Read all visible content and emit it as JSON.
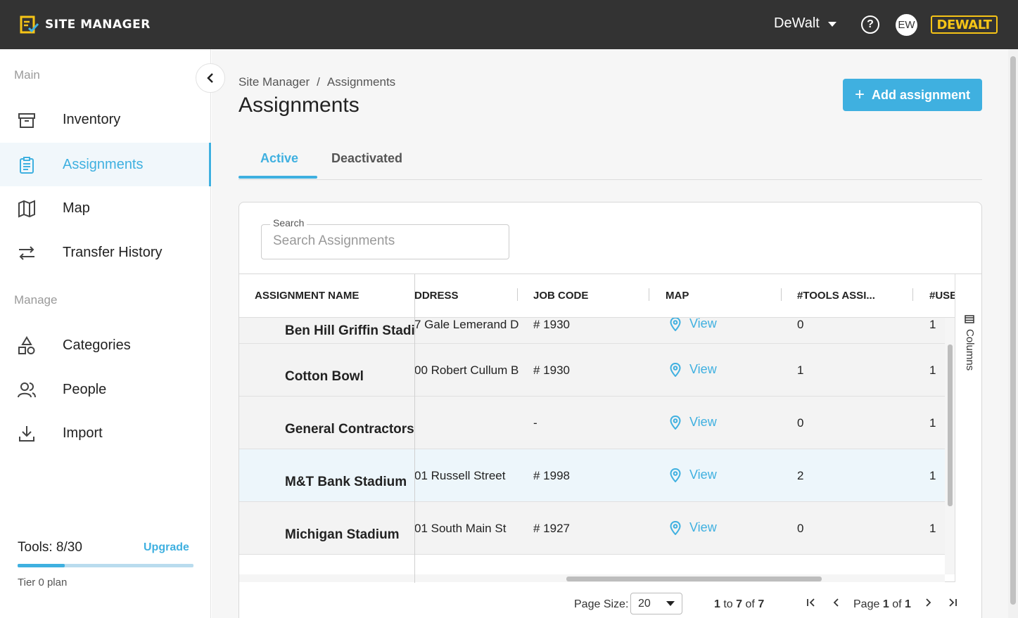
{
  "app": {
    "name": "SITE MANAGER",
    "org": "DeWalt",
    "avatar_initials": "EW",
    "brand": "DEWALT"
  },
  "sidebar": {
    "section_main": "Main",
    "section_manage": "Manage",
    "items": [
      {
        "label": "Inventory",
        "icon": "archive-box-icon"
      },
      {
        "label": "Assignments",
        "icon": "clipboard-icon",
        "active": true
      },
      {
        "label": "Map",
        "icon": "map-icon"
      },
      {
        "label": "Transfer History",
        "icon": "transfer-arrows-icon"
      },
      {
        "label": "Categories",
        "icon": "shapes-icon"
      },
      {
        "label": "People",
        "icon": "people-icon"
      },
      {
        "label": "Import",
        "icon": "download-icon"
      }
    ],
    "tools_label": "Tools: 8/30",
    "tools_used_fraction": 0.267,
    "upgrade": "Upgrade",
    "tier": "Tier 0 plan"
  },
  "main": {
    "breadcrumb": {
      "root": "Site Manager",
      "sep": "/",
      "current": "Assignments"
    },
    "title": "Assignments",
    "add_button": "Add assignment",
    "tabs": [
      {
        "label": "Active",
        "active": true
      },
      {
        "label": "Deactivated"
      }
    ],
    "search": {
      "legend": "Search",
      "placeholder": "Search Assignments"
    },
    "columns_label": "Columns",
    "table": {
      "headers": [
        "ASSIGNMENT NAME",
        "DDRESS",
        "JOB CODE",
        "MAP",
        "#TOOLS ASSI...",
        "#USE"
      ],
      "rows": [
        {
          "name": "Ben Hill Griffin Stadium",
          "address": "7 Gale Lemerand D",
          "job": "# 1930",
          "map": "View",
          "tools": "0",
          "users": "1"
        },
        {
          "name": "Cotton Bowl",
          "address": "00 Robert Cullum B",
          "job": "# 1930",
          "map": "View",
          "tools": "1",
          "users": "1"
        },
        {
          "name": "General Contractors",
          "address": "",
          "job": "-",
          "map": "View",
          "tools": "0",
          "users": "1"
        },
        {
          "name": "M&T Bank Stadium",
          "address": "01 Russell Street",
          "job": "# 1998",
          "map": "View",
          "tools": "2",
          "users": "1"
        },
        {
          "name": "Michigan Stadium",
          "address": "01 South Main St",
          "job": "# 1927",
          "map": "View",
          "tools": "0",
          "users": "1"
        }
      ]
    },
    "pager": {
      "page_size_label": "Page Size:",
      "page_size": "20",
      "range_start": "1",
      "range_to": "to",
      "range_end": "7",
      "range_of": "of",
      "range_total": "7",
      "page_label": "Page",
      "page_current": "1",
      "page_of": "of",
      "page_total": "1"
    }
  },
  "colors": {
    "accent": "#3fb0e0",
    "topbar": "#333333",
    "brand_yellow": "#f6c416"
  }
}
